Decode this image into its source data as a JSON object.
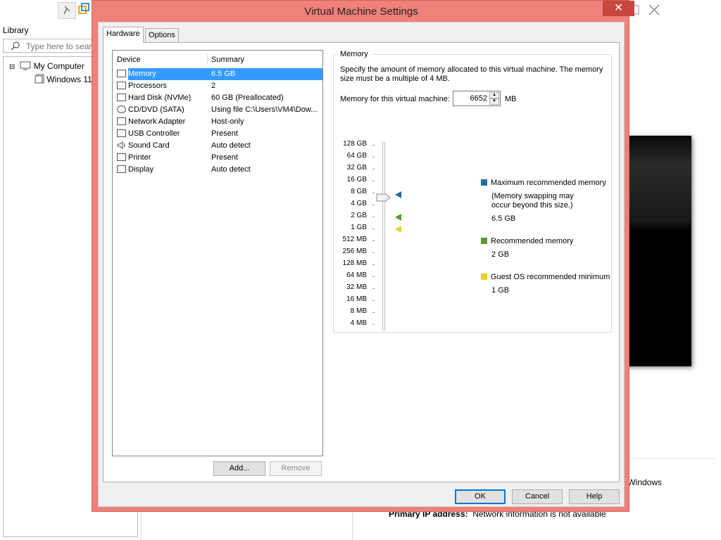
{
  "background": {
    "library_title": "Library",
    "search_placeholder": "Type here to search",
    "tree": [
      {
        "label": "My Computer",
        "expander": "⊟"
      },
      {
        "label": "Windows 11"
      }
    ],
    "windows_path": "\\Windows",
    "primary_ip_label": "Primary IP address:",
    "primary_ip_value": "Network information is not available"
  },
  "dialog": {
    "title": "Virtual Machine Settings",
    "close_glyph": "✕",
    "tabs": [
      {
        "label": "Hardware",
        "active": true
      },
      {
        "label": "Options",
        "active": false
      }
    ],
    "device_header": "Device",
    "summary_header": "Summary",
    "devices": [
      {
        "name": "Memory",
        "summary": "6.5 GB",
        "icon": "memory-icon",
        "selected": true
      },
      {
        "name": "Processors",
        "summary": "2",
        "icon": "processor-icon"
      },
      {
        "name": "Hard Disk (NVMe)",
        "summary": "60 GB (Preallocated)",
        "icon": "hard-disk-icon"
      },
      {
        "name": "CD/DVD (SATA)",
        "summary": "Using file C:\\Users\\VM4\\Dow...",
        "icon": "cd-dvd-icon"
      },
      {
        "name": "Network Adapter",
        "summary": "Host-only",
        "icon": "network-icon"
      },
      {
        "name": "USB Controller",
        "summary": "Present",
        "icon": "usb-icon"
      },
      {
        "name": "Sound Card",
        "summary": "Auto detect",
        "icon": "speaker-icon"
      },
      {
        "name": "Printer",
        "summary": "Present",
        "icon": "printer-icon"
      },
      {
        "name": "Display",
        "summary": "Auto detect",
        "icon": "monitor-icon"
      }
    ],
    "add_button": "Add...",
    "remove_button": "Remove",
    "memory": {
      "group_title": "Memory",
      "description": "Specify the amount of memory allocated to this virtual machine. The memory size must be a multiple of 4 MB.",
      "field_label": "Memory for this virtual machine:",
      "value": "6652",
      "unit": "MB",
      "scale": [
        "128 GB",
        "64 GB",
        "32 GB",
        "16 GB",
        "8 GB",
        "4 GB",
        "2 GB",
        "1 GB",
        "512 MB",
        "256 MB",
        "128 MB",
        "64 MB",
        "32 MB",
        "16 MB",
        "8 MB",
        "4 MB"
      ],
      "legend": [
        {
          "title": "Maximum recommended memory",
          "note": "(Memory swapping may occur beyond this size.)",
          "value": "6.5 GB",
          "color": "#1e6f9f"
        },
        {
          "title": "Recommended memory",
          "value": "2 GB",
          "color": "#5a9a2a"
        },
        {
          "title": "Guest OS recommended minimum",
          "value": "1 GB",
          "color": "#e8d21d"
        }
      ]
    },
    "ok_button": "OK",
    "cancel_button": "Cancel",
    "help_button": "Help"
  }
}
